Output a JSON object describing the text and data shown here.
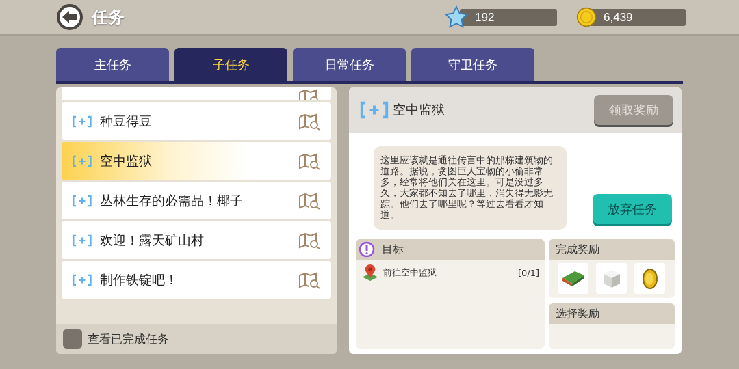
{
  "header": {
    "title": "任务",
    "gems": "192",
    "coins": "6,439"
  },
  "tabs": [
    {
      "label": "主任务",
      "selected": false
    },
    {
      "label": "子任务",
      "selected": true
    },
    {
      "label": "日常任务",
      "selected": false
    },
    {
      "label": "守卫任务",
      "selected": false
    }
  ],
  "quests": [
    {
      "name": "种豆得豆",
      "selected": false
    },
    {
      "name": "空中监狱",
      "selected": true
    },
    {
      "name": "丛林生存的必需品！椰子",
      "selected": false
    },
    {
      "name": "欢迎！露天矿山村",
      "selected": false
    },
    {
      "name": "制作铁锭吧！",
      "selected": false
    }
  ],
  "show_completed": {
    "label": "查看已完成任务",
    "checked": false
  },
  "detail": {
    "title": "空中监狱",
    "claim_button": "领取奖励",
    "claim_disabled": true,
    "description": "这里应该就是通往传言中的那栋建筑物的道路。据说，贪图巨人宝物的小偷非常多，经常将他们关在这里。可是没过多久，大家都不知去了哪里，消失得无影无踪。他们去了哪里呢？等过去看看才知道。",
    "abandon_button": "放弃任务",
    "objectives_title": "目标",
    "objectives": [
      {
        "text": "前往空中监狱",
        "progress": "[0/1]"
      }
    ],
    "rewards_title": "完成奖励",
    "rewards": [
      {
        "kind": "book"
      },
      {
        "kind": "cube"
      },
      {
        "kind": "coin"
      }
    ],
    "choice_title": "选择奖励"
  }
}
